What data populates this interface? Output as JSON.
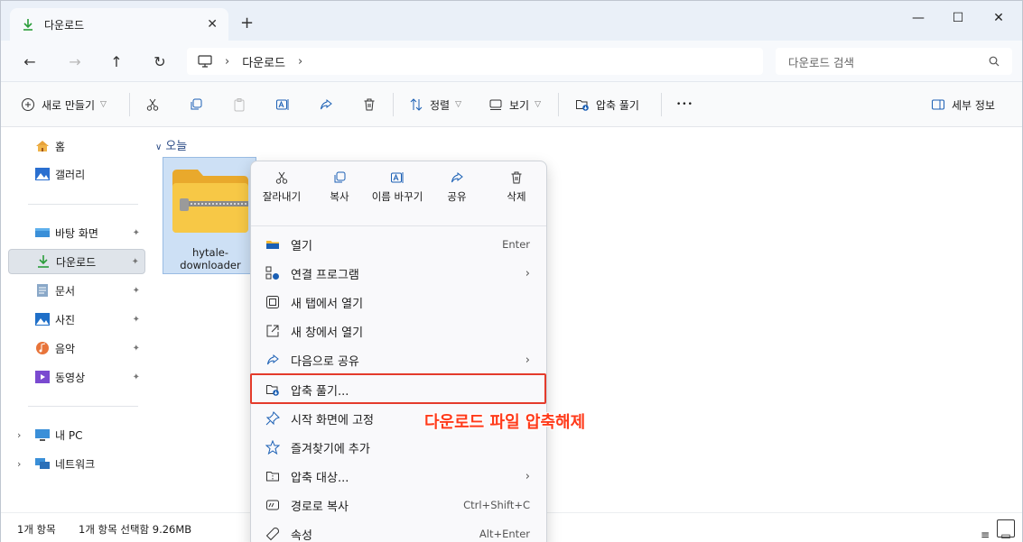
{
  "tab": {
    "title": "다운로드",
    "close": "✕"
  },
  "newTab": "+",
  "windowControls": {
    "minimize": "—",
    "maximize": "☐",
    "close": "✕"
  },
  "nav": {
    "back": "←",
    "forward": "→",
    "up": "↑",
    "refresh": "↻"
  },
  "breadcrumb": {
    "separator": "›",
    "items": [
      "다운로드"
    ],
    "trailing": "›"
  },
  "search": {
    "placeholder": "다운로드 검색"
  },
  "commandBar": {
    "new": "새로 만들기",
    "sort": "정렬",
    "view": "보기",
    "extract": "압축 풀기",
    "more": "•••",
    "details": "세부 정보"
  },
  "sidebar": {
    "items": [
      {
        "label": "홈"
      },
      {
        "label": "갤러리"
      },
      {
        "label": "바탕 화면"
      },
      {
        "label": "다운로드"
      },
      {
        "label": "문서"
      },
      {
        "label": "사진"
      },
      {
        "label": "음악"
      },
      {
        "label": "동영상"
      },
      {
        "label": "내 PC"
      },
      {
        "label": "네트워크"
      }
    ],
    "pin": "📌"
  },
  "content": {
    "groupHeader": "오늘",
    "file": {
      "name": "hytale-downloader"
    }
  },
  "statusBar": {
    "count": "1개 항목",
    "selection": "1개 항목 선택함 9.26MB"
  },
  "contextMenu": {
    "quickActions": [
      {
        "label": "잘라내기"
      },
      {
        "label": "복사"
      },
      {
        "label": "이름 바꾸기"
      },
      {
        "label": "공유"
      },
      {
        "label": "삭제"
      }
    ],
    "items": [
      {
        "label": "열기",
        "shortcut": "Enter"
      },
      {
        "label": "연결 프로그램",
        "arrow": "›"
      },
      {
        "label": "새 탭에서 열기"
      },
      {
        "label": "새 창에서 열기"
      },
      {
        "label": "다음으로 공유",
        "arrow": "›"
      },
      {
        "label": "압축 풀기..."
      },
      {
        "label": "시작 화면에 고정"
      },
      {
        "label": "즐겨찾기에 추가"
      },
      {
        "label": "압축 대상...",
        "arrow": "›"
      },
      {
        "label": "경로로 복사",
        "shortcut": "Ctrl+Shift+C"
      },
      {
        "label": "속성",
        "shortcut": "Alt+Enter"
      }
    ]
  },
  "annotation": {
    "text": "다운로드 파일 압축해제"
  },
  "colors": {
    "accent": "#0067c0",
    "highlight": "#e43b2b",
    "annotation": "#ff3a1a",
    "folder": "#f5c036"
  }
}
